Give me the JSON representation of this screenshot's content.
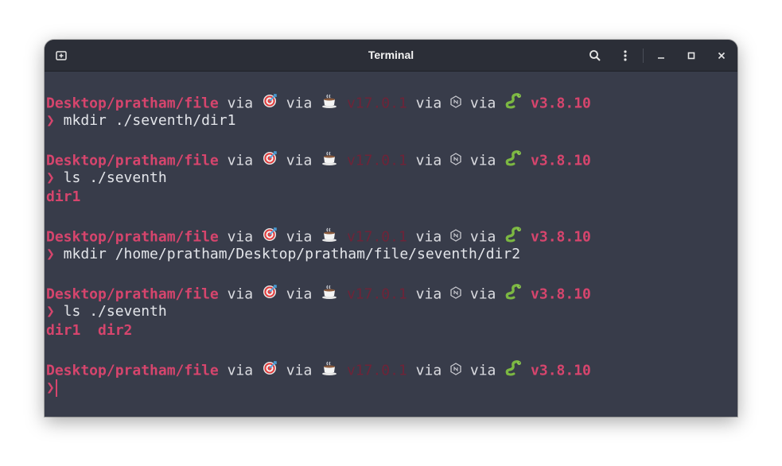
{
  "window": {
    "title": "Terminal"
  },
  "titlebar": {
    "new_tab_icon": "new-tab-icon",
    "search_icon": "search-icon",
    "menu_icon": "kebab-menu-icon",
    "minimize_icon": "minimize-icon",
    "maximize_icon": "maximize-icon",
    "close_icon": "close-icon"
  },
  "prompt": {
    "path": "Desktop/pratham/file",
    "via": "via",
    "java_version": "v17.0.1",
    "python_version": "v3.8.10",
    "chevron": "❯",
    "icons": [
      "target-icon",
      "coffee-icon",
      "node-hex-icon",
      "snake-icon"
    ]
  },
  "colors": {
    "accent": "#d6456d",
    "background": "#383c4a",
    "titlebar": "#2b2e37",
    "java_dim": "#6e2438"
  },
  "session": [
    {
      "command": "mkdir ./seventh/dir1",
      "output": []
    },
    {
      "command": "ls ./seventh",
      "output": [
        "dir1"
      ]
    },
    {
      "command": "mkdir /home/pratham/Desktop/pratham/file/seventh/dir2",
      "output": []
    },
    {
      "command": "ls ./seventh",
      "output": [
        "dir1  dir2"
      ]
    },
    {
      "command": "",
      "output": []
    }
  ]
}
